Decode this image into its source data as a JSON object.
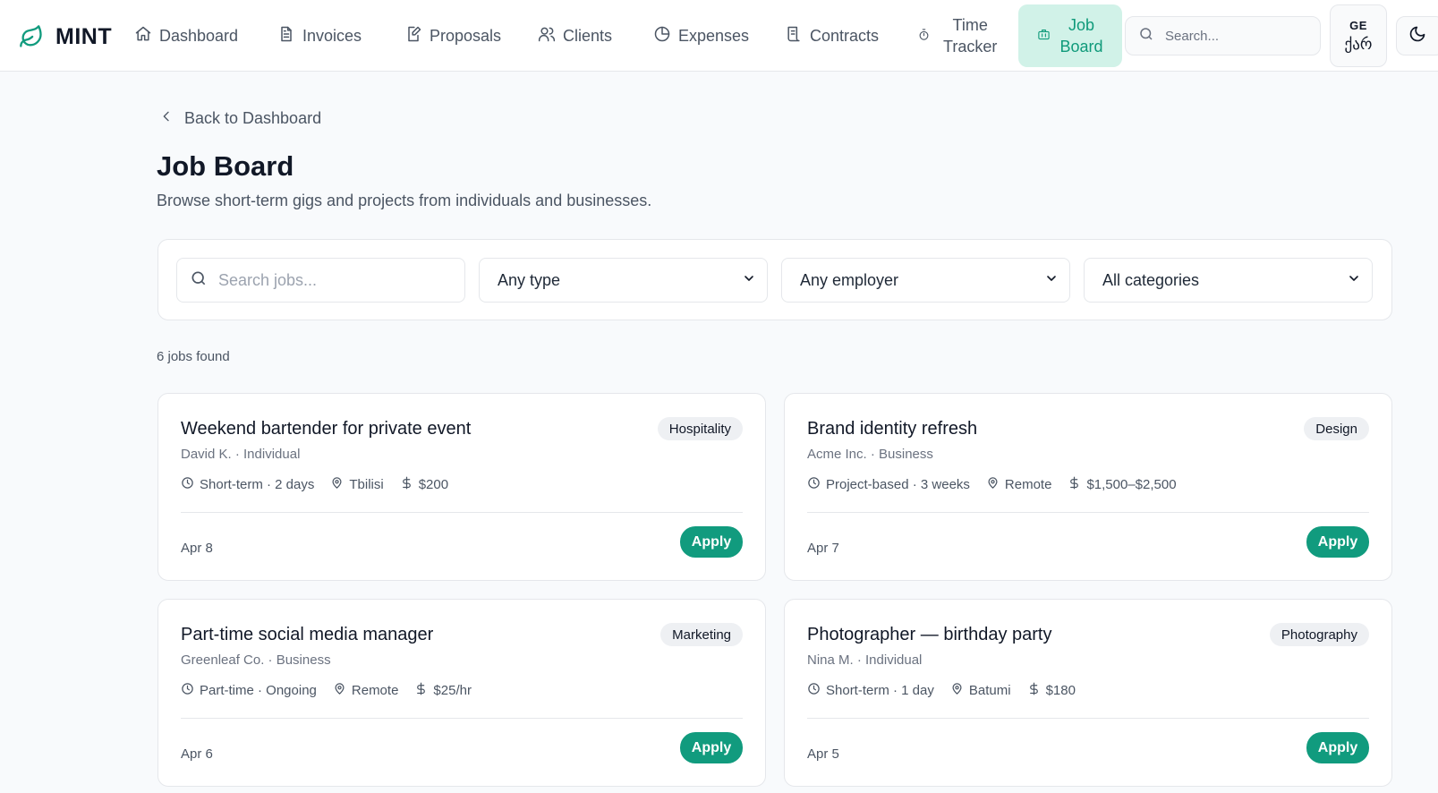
{
  "brand": {
    "name": "MINT",
    "logo_icon": "leaf-icon",
    "accent_color": "#119b7e"
  },
  "nav": {
    "items": [
      {
        "label": "Dashboard",
        "icon": "home-icon"
      },
      {
        "label": "Invoices",
        "icon": "document-icon"
      },
      {
        "label": "Proposals",
        "icon": "edit-document-icon"
      },
      {
        "label": "Clients",
        "icon": "users-icon"
      },
      {
        "label": "Expenses",
        "icon": "pie-chart-icon"
      },
      {
        "label": "Contracts",
        "icon": "scroll-icon"
      },
      {
        "label_line1": "Time",
        "label_line2": "Tracker",
        "icon": "timer-icon"
      },
      {
        "label_line1": "Job",
        "label_line2": "Board",
        "icon": "briefcase-icon",
        "active": true
      }
    ],
    "search_placeholder": "Search...",
    "language": {
      "code": "GE",
      "native": "ქარ"
    },
    "theme_icon": "moon-icon"
  },
  "page": {
    "back_label": "Back to Dashboard",
    "title": "Job Board",
    "subtitle": "Browse short-term gigs and projects from individuals and businesses."
  },
  "filters": {
    "search_placeholder": "Search jobs...",
    "type": "Any type",
    "employer": "Any employer",
    "category": "All categories"
  },
  "results_count": "6 jobs found",
  "jobs": [
    {
      "title": "Weekend bartender for private event",
      "category": "Hospitality",
      "employer": "David K. · Individual",
      "duration": "Short-term · 2 days",
      "location": "Tbilisi",
      "pay": "$200",
      "date": "Apr 8",
      "apply_label": "Apply"
    },
    {
      "title": "Brand identity refresh",
      "category": "Design",
      "employer": "Acme Inc. · Business",
      "duration": "Project-based · 3 weeks",
      "location": "Remote",
      "pay": "$1,500–$2,500",
      "date": "Apr 7",
      "apply_label": "Apply"
    },
    {
      "title": "Part-time social media manager",
      "category": "Marketing",
      "employer": "Greenleaf Co. · Business",
      "duration": "Part-time · Ongoing",
      "location": "Remote",
      "pay": "$25/hr",
      "date": "Apr 6",
      "apply_label": "Apply"
    },
    {
      "title": "Photographer — birthday party",
      "category": "Photography",
      "employer": "Nina M. · Individual",
      "duration": "Short-term · 1 day",
      "location": "Batumi",
      "pay": "$180",
      "date": "Apr 5",
      "apply_label": "Apply"
    }
  ]
}
